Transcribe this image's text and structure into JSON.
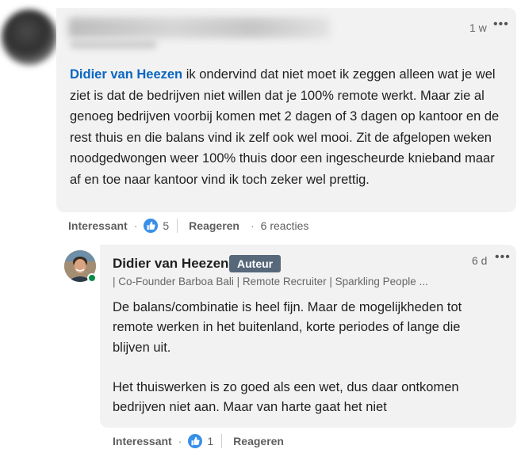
{
  "comment": {
    "time": "1 w",
    "more": "•••",
    "mention": "Didier van Heezen",
    "text": "ik ondervind dat niet moet ik zeggen alleen wat je wel ziet is dat de bedrijven niet willen dat je 100% remote werkt. Maar zie al genoeg bedrijven voorbij komen met 2 dagen of 3 dagen op kantoor en de rest thuis en die balans vind ik zelf ook wel mooi. Zit de afgelopen weken noodgedwongen weer 100% thuis door een ingescheurde knieband maar af en toe naar kantoor vind ik toch zeker wel prettig.",
    "actions": {
      "like_label": "Interessant",
      "like_count": "5",
      "reply_label": "Reageren",
      "replies": "6 reacties"
    }
  },
  "reply": {
    "author": "Didier van Heezen",
    "badge": "Auteur",
    "time": "6 d",
    "more": "•••",
    "headline": "| Co-Founder Barboa Bali | Remote Recruiter | Sparkling People ...",
    "text1": "De balans/combinatie is heel fijn. Maar de mogelijkheden tot remote werken in het buitenland, korte periodes of lange die blijven uit.",
    "text2": "Het thuiswerken is zo goed als een wet, dus daar ontkomen bedrijven niet aan. Maar van harte gaat het niet",
    "actions": {
      "like_label": "Interessant",
      "like_count": "1",
      "reply_label": "Reageren"
    }
  },
  "colors": {
    "link": "#0a66c2",
    "bubble": "#f2f2f2",
    "badge": "#56687a",
    "like": "#378fe9",
    "online": "#0a8c47"
  }
}
